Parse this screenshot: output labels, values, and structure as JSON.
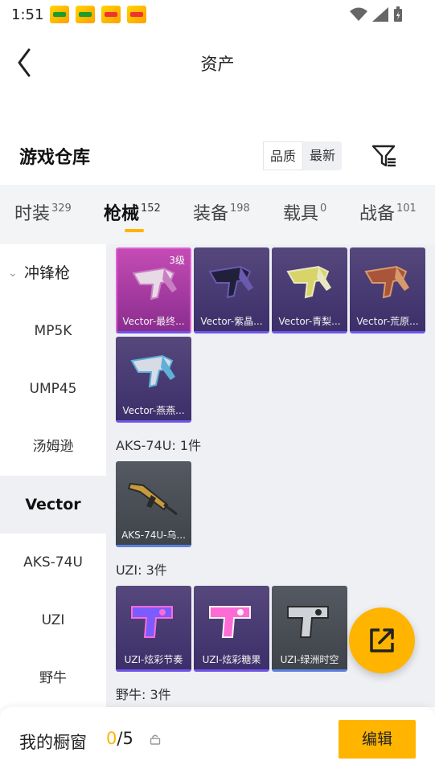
{
  "status": {
    "time": "1:51",
    "notification_icons": [
      "app-notification-icon",
      "app-notification-icon",
      "game-notification-icon",
      "game-notification-icon"
    ]
  },
  "header": {
    "title": "资产"
  },
  "warehouse": {
    "title": "游戏仓库",
    "sort_options": [
      "品质",
      "最新"
    ],
    "active_sort": "品质"
  },
  "tabs": [
    {
      "label": "时装",
      "count": "329"
    },
    {
      "label": "枪械",
      "count": "152"
    },
    {
      "label": "装备",
      "count": "198"
    },
    {
      "label": "载具",
      "count": "0"
    },
    {
      "label": "战备",
      "count": "101"
    }
  ],
  "active_tab": "枪械",
  "sidebar": {
    "group": "冲锋枪",
    "items": [
      "MP5K",
      "UMP45",
      "汤姆逊",
      "Vector",
      "AKS-74U",
      "UZI",
      "野牛"
    ],
    "active": "Vector"
  },
  "vector_cards": [
    {
      "label": "Vector-最终...",
      "level": "3级",
      "style": "pink",
      "colors": [
        "#e8d9e6",
        "#c97ec2"
      ]
    },
    {
      "label": "Vector-紫晶...",
      "level": "",
      "style": "purple",
      "colors": [
        "#20203a",
        "#6a5ab0"
      ]
    },
    {
      "label": "Vector-青梨...",
      "level": "",
      "style": "purple",
      "colors": [
        "#d8d46a",
        "#e8e8c0"
      ]
    },
    {
      "label": "Vector-荒原...",
      "level": "",
      "style": "purple",
      "colors": [
        "#a8553a",
        "#d89a6a"
      ]
    },
    {
      "label": "Vector-燕燕...",
      "level": "",
      "style": "purple",
      "colors": [
        "#d6dbe6",
        "#5fb0d8"
      ]
    }
  ],
  "sections": [
    {
      "title": "AKS-74U: 1件",
      "cards": [
        {
          "label": "AKS-74U-乌...",
          "style": "grey",
          "colors": [
            "#c79a3c",
            "#2a2a2a"
          ]
        }
      ]
    },
    {
      "title": "UZI: 3件",
      "cards": [
        {
          "label": "UZI-炫彩节奏",
          "style": "purple",
          "colors": [
            "#7b5cff",
            "#ff6ad5"
          ]
        },
        {
          "label": "UZI-炫彩糖果",
          "style": "purple",
          "colors": [
            "#ff6ad5",
            "#f4f4f4"
          ]
        },
        {
          "label": "UZI-绿洲时空",
          "style": "grey",
          "colors": [
            "#cfd3d8",
            "#2a2a2a"
          ]
        }
      ]
    },
    {
      "title": "野牛: 3件",
      "cards": []
    }
  ],
  "bottom_bar": {
    "showcase_label": "我的橱窗",
    "showcase_current": "0",
    "showcase_total": "/5",
    "edit_label": "编辑"
  },
  "colors": {
    "accent": "#ffb400",
    "rare_frame": "#6f54ea",
    "panel_bg": "#eef0f3"
  }
}
